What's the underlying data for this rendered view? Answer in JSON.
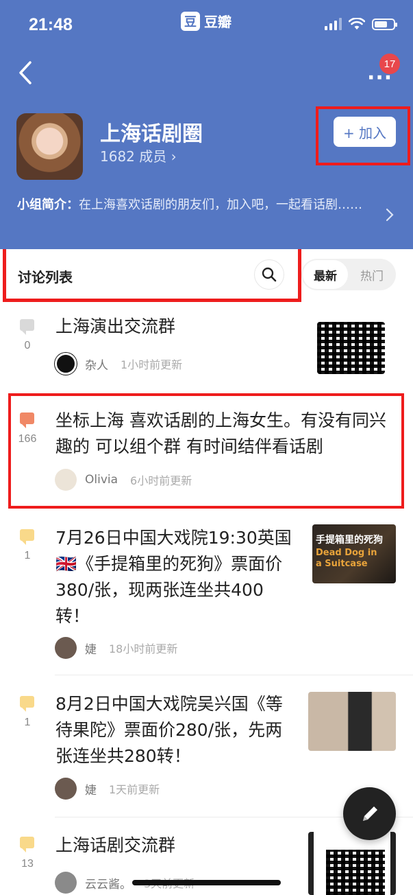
{
  "status": {
    "time": "21:48",
    "app_name": "豆瓣",
    "app_logo_char": "豆"
  },
  "header": {
    "group_name": "上海话剧圈",
    "members": "1682 成员 ›",
    "notification_count": "17",
    "join_label": "+ 加入",
    "intro_label": "小组简介：",
    "intro_text": "在上海喜欢话剧的朋友们，加入吧，一起看话剧……"
  },
  "discussion": {
    "title": "讨论列表",
    "sort_latest": "最新",
    "sort_hot": "热门"
  },
  "posts": [
    {
      "title": "上海演出交流群",
      "count": "0",
      "author": "杂人",
      "time": "1小时前更新",
      "bubble_color": "#d9d9d9"
    },
    {
      "title": "坐标上海 喜欢话剧的上海女生。有没有同兴趣的 可以组个群 有时间结伴看话剧",
      "count": "166",
      "author": "Olivia",
      "time": "6小时前更新",
      "bubble_color": "#F08866"
    },
    {
      "title": "7月26日中国大戏院19:30英国 🇬🇧《手提箱里的死狗》票面价380/张，现两张连坐共400转！",
      "count": "1",
      "author": "婕",
      "time": "18小时前更新",
      "bubble_color": "#F9D98A",
      "thumb_title": "手提箱里的死狗",
      "thumb_en1": "Dead Dog in",
      "thumb_en2": "a Suitcase"
    },
    {
      "title": "8月2日中国大戏院吴兴国《等待果陀》票面价280/张，先两张连坐共280转！",
      "count": "1",
      "author": "婕",
      "time": "1天前更新",
      "bubble_color": "#F9D98A"
    },
    {
      "title": "上海话剧交流群",
      "count": "13",
      "author": "云云酱。",
      "time": "3天前更新",
      "bubble_color": "#F9D98A"
    }
  ],
  "colors": {
    "header_bg": "#5577C3",
    "highlight": "#EE1C1C",
    "badge": "#E8474C"
  }
}
